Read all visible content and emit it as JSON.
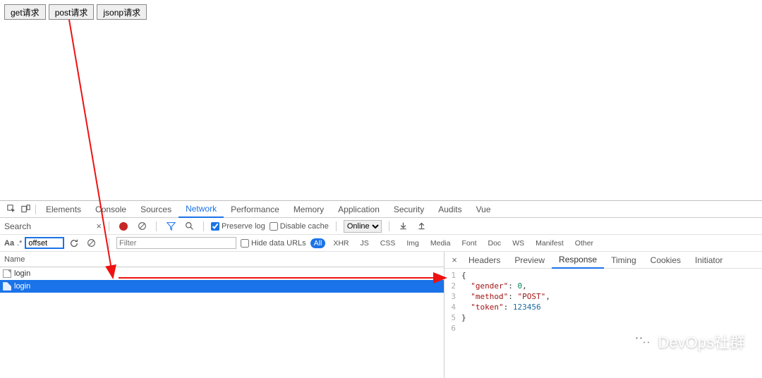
{
  "pageButtons": {
    "get": "get请求",
    "post": "post请求",
    "jsonp": "jsonp请求"
  },
  "devtoolsTabs": {
    "elements": "Elements",
    "console": "Console",
    "sources": "Sources",
    "network": "Network",
    "performance": "Performance",
    "memory": "Memory",
    "application": "Application",
    "security": "Security",
    "audits": "Audits",
    "vue": "Vue"
  },
  "toolbar": {
    "searchLabel": "Search",
    "filterPlaceholder": "Filter",
    "preserveLog": "Preserve log",
    "disableCache": "Disable cache",
    "online": "Online"
  },
  "row3": {
    "aa": "Aa",
    "regex": ".*",
    "searchValue": "offset",
    "hideDataUrls": "Hide data URLs",
    "types": {
      "all": "All",
      "xhr": "XHR",
      "js": "JS",
      "css": "CSS",
      "img": "Img",
      "media": "Media",
      "font": "Font",
      "doc": "Doc",
      "ws": "WS",
      "manifest": "Manifest",
      "other": "Other"
    }
  },
  "requests": {
    "header": "Name",
    "r0": "login",
    "r1": "login"
  },
  "rightTabs": {
    "headers": "Headers",
    "preview": "Preview",
    "response": "Response",
    "timing": "Timing",
    "cookies": "Cookies",
    "initiator": "Initiator"
  },
  "json": {
    "keys": {
      "gender": "\"gender\"",
      "method": "\"method\"",
      "token": "\"token\""
    },
    "vals": {
      "gender": "0",
      "method": "\"POST\"",
      "token": "123456"
    },
    "lines": {
      "l1": "1",
      "l2": "2",
      "l3": "3",
      "l4": "4",
      "l5": "5",
      "l6": "6"
    }
  },
  "watermark": "DevOps社群"
}
